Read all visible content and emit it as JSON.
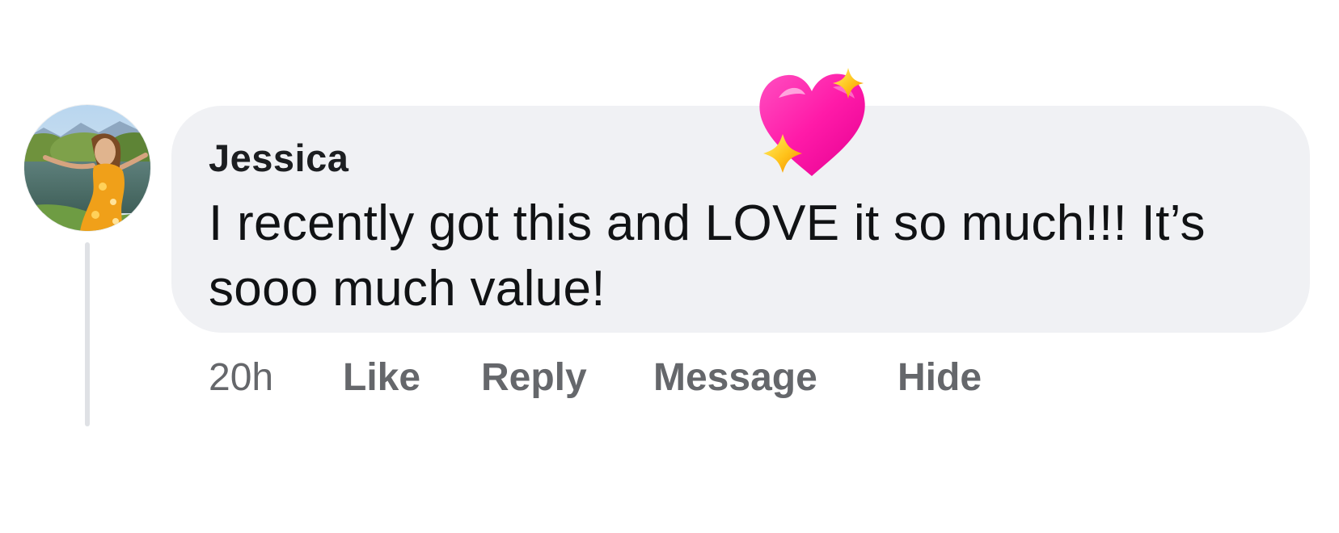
{
  "comment": {
    "author": "Jessica",
    "text": "I recently got this and LOVE it so much!!! It’s sooo much value!",
    "timestamp": "20h",
    "reaction_icon": "sparkling-heart-icon",
    "avatar_icon": "profile-photo",
    "actions": {
      "like": "Like",
      "reply": "Reply",
      "message": "Message",
      "hide": "Hide"
    }
  },
  "colors": {
    "bubble_background": "#f0f1f4",
    "author_text": "#1c1e21",
    "comment_text": "#101214",
    "action_text": "#65676b",
    "thread_line": "#dfe1e5",
    "heart": "#ff1aa8",
    "sparkle": "#ffc21a"
  }
}
